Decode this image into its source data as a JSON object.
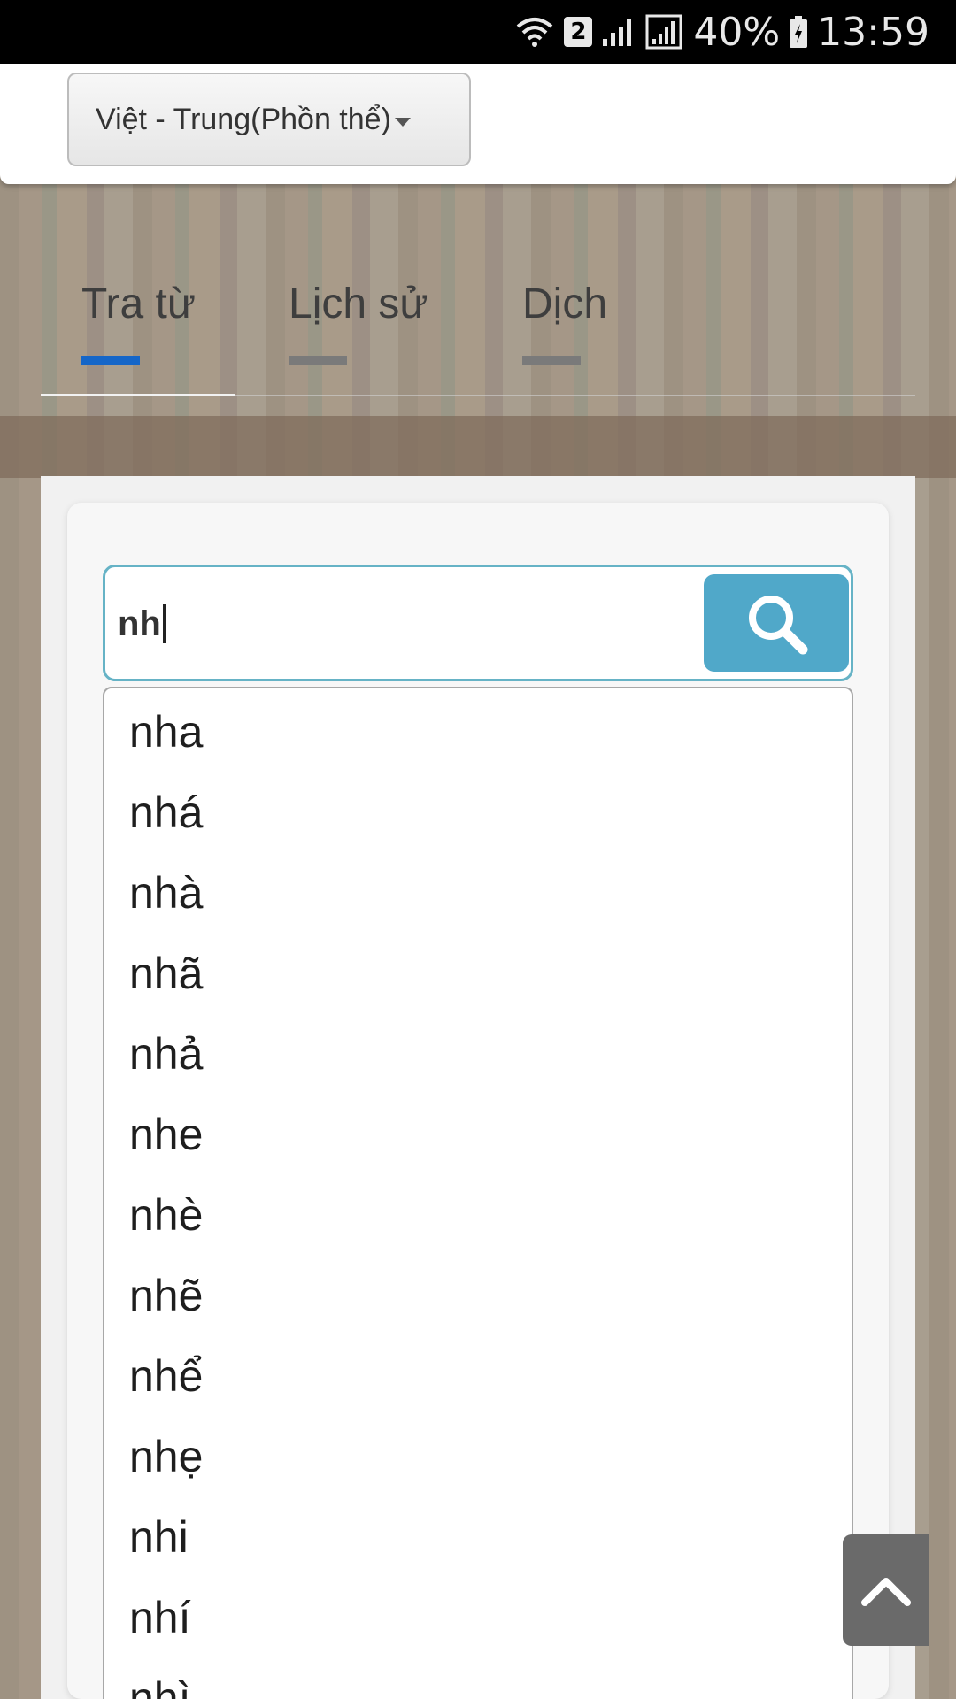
{
  "status_bar": {
    "sim_slot": "2",
    "battery_percent": "40%",
    "time": "13:59"
  },
  "header": {
    "language_selector": "Việt - Trung(Phồn thể)"
  },
  "tabs": [
    {
      "label": "Tra từ",
      "active": true
    },
    {
      "label": "Lịch sử",
      "active": false
    },
    {
      "label": "Dịch",
      "active": false
    }
  ],
  "search": {
    "value": "nh"
  },
  "suggestions": [
    "nha",
    "nhá",
    "nhà",
    "nhã",
    "nhả",
    "nhe",
    "nhè",
    "nhẽ",
    "nhể",
    "nhẹ",
    "nhi",
    "nhí",
    "nhì"
  ],
  "colors": {
    "tab_active": "#1566c8",
    "search_button": "#50a8c9",
    "search_border": "#66b3c6"
  }
}
